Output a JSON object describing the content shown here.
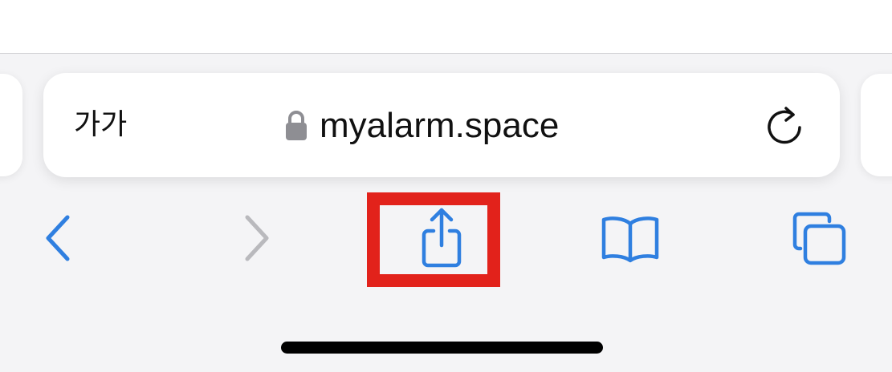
{
  "browser": {
    "text_size_label": "가가",
    "url": "myalarm.space"
  },
  "icons": {
    "lock": "lock-icon",
    "reload": "reload-icon",
    "back": "chevron-left-icon",
    "forward": "chevron-right-icon",
    "share": "share-icon",
    "bookmarks": "book-icon",
    "tabs": "tabs-icon"
  },
  "toolbar": {
    "back_enabled": true,
    "forward_enabled": false
  },
  "colors": {
    "accent": "#2f7fe0",
    "disabled": "#b9b9bd",
    "highlight": "#e2221b",
    "toolbar_bg": "#f4f4f6"
  }
}
